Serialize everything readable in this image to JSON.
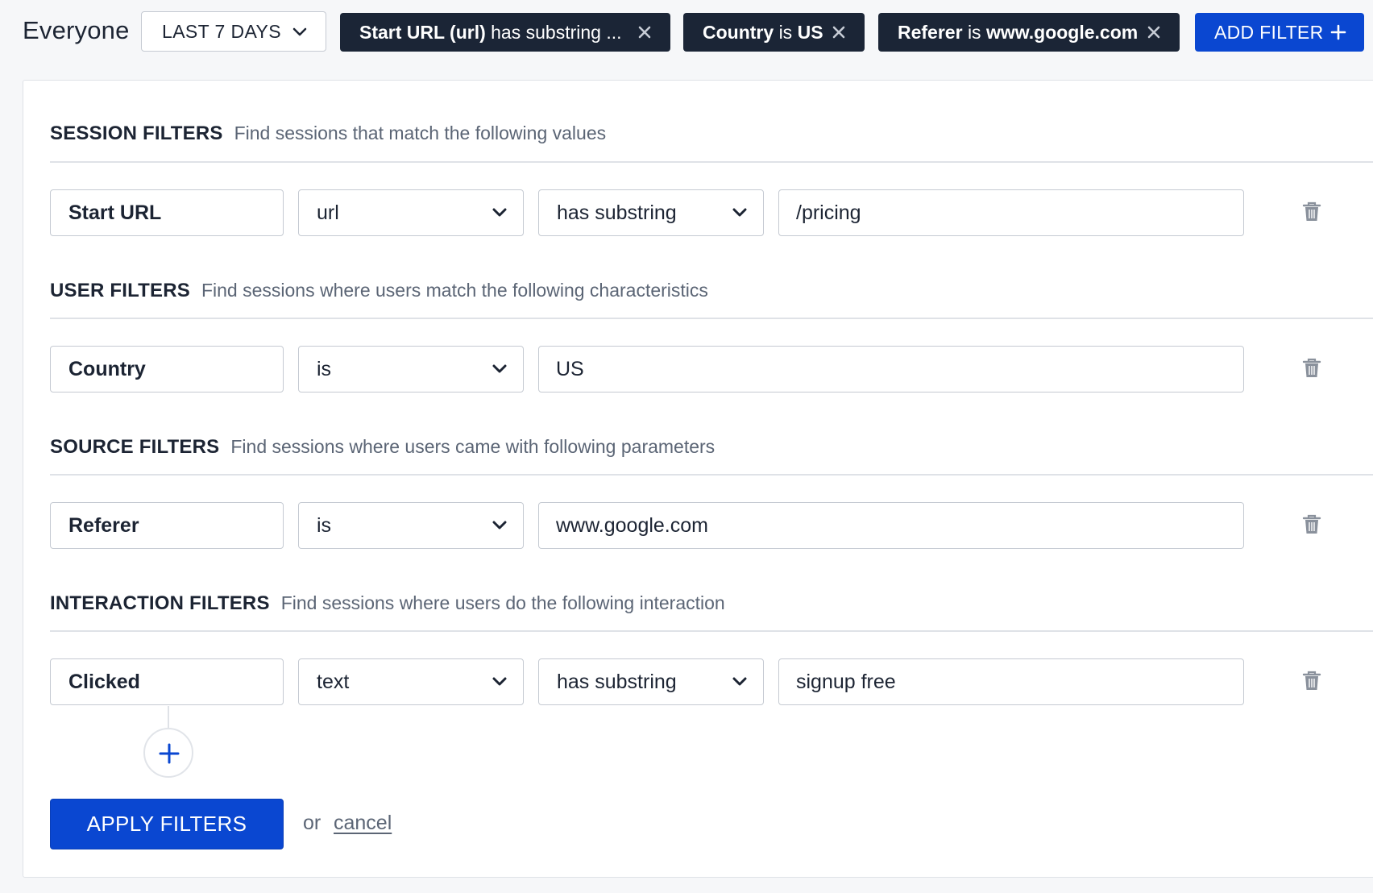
{
  "topbar": {
    "audience": "Everyone",
    "range": "LAST 7 DAYS",
    "chips": [
      {
        "key": "Start URL (url)",
        "op": "has substring",
        "value": "...",
        "truncated": true
      },
      {
        "key": "Country",
        "op": "is",
        "value": "US"
      },
      {
        "key": "Referer",
        "op": "is",
        "value": "www.google.com"
      }
    ],
    "add_filter_label": "ADD FILTER"
  },
  "sections": {
    "session": {
      "title": "SESSION FILTERS",
      "desc": "Find sessions that match the following values"
    },
    "user": {
      "title": "USER FILTERS",
      "desc": "Find sessions where users match the following characteristics"
    },
    "source": {
      "title": "SOURCE FILTERS",
      "desc": "Find sessions where users came with following parameters"
    },
    "interaction": {
      "title": "INTERACTION FILTERS",
      "desc": "Find sessions where users do the following interaction"
    }
  },
  "rows": {
    "session": {
      "name": "Start URL",
      "property": "url",
      "operator": "has substring",
      "value": "/pricing"
    },
    "user": {
      "name": "Country",
      "operator": "is",
      "value": "US"
    },
    "source": {
      "name": "Referer",
      "operator": "is",
      "value": "www.google.com"
    },
    "interaction": {
      "name": "Clicked",
      "property": "text",
      "operator": "has substring",
      "value": "signup free"
    }
  },
  "footer": {
    "apply_label": "APPLY FILTERS",
    "or_label": "or",
    "cancel_label": "cancel"
  },
  "colors": {
    "primary": "#0a47d1",
    "chip_bg": "#1b2536",
    "muted_text": "#5b6575",
    "border": "#c5cad2"
  },
  "icons": [
    "chevron-down-icon",
    "close-icon",
    "plus-icon",
    "trash-icon"
  ]
}
